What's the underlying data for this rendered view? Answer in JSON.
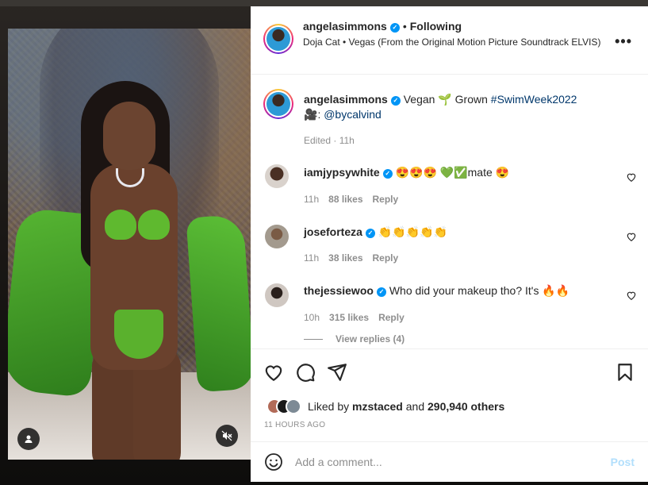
{
  "header": {
    "username": "angelasimmons",
    "separator": "•",
    "follow_status": "Following",
    "audio": "Doja Cat • Vegas (From the Original Motion Picture Soundtrack ELVIS)",
    "more_icon": "more-horizontal-icon"
  },
  "caption": {
    "username": "angelasimmons",
    "text_1": "Vegan",
    "plant_emoji": "🌱",
    "text_2": "Grown",
    "hashtag": "#SwimWeek2022",
    "camera_emoji": "🎥",
    "colon": ":",
    "mention": "@bycalvind",
    "edited": "Edited · 11h"
  },
  "comments": [
    {
      "username": "iamjypsywhite",
      "text": "😍😍😍 💚✅mate 😍",
      "time": "11h",
      "likes": "88 likes",
      "reply": "Reply"
    },
    {
      "username": "joseforteza",
      "text": "👏👏👏👏👏",
      "time": "11h",
      "likes": "38 likes",
      "reply": "Reply"
    },
    {
      "username": "thejessiewoo",
      "text": "Who did your makeup tho? It's 🔥🔥",
      "time": "10h",
      "likes": "315 likes",
      "reply": "Reply"
    }
  ],
  "view_replies": "View replies (4)",
  "actions": {
    "like_icon": "heart-icon",
    "comment_icon": "comment-icon",
    "share_icon": "send-icon",
    "save_icon": "bookmark-icon"
  },
  "likes": {
    "prefix": "Liked by",
    "user": "mzstaced",
    "middle": "and",
    "count": "290,940 others"
  },
  "timestamp": "11 HOURS AGO",
  "composer": {
    "placeholder": "Add a comment...",
    "post_label": "Post"
  },
  "colors": {
    "link": "#00376b",
    "verified": "#0095f6",
    "muted": "#8e8e8e",
    "post_disabled": "#b2dffc"
  }
}
